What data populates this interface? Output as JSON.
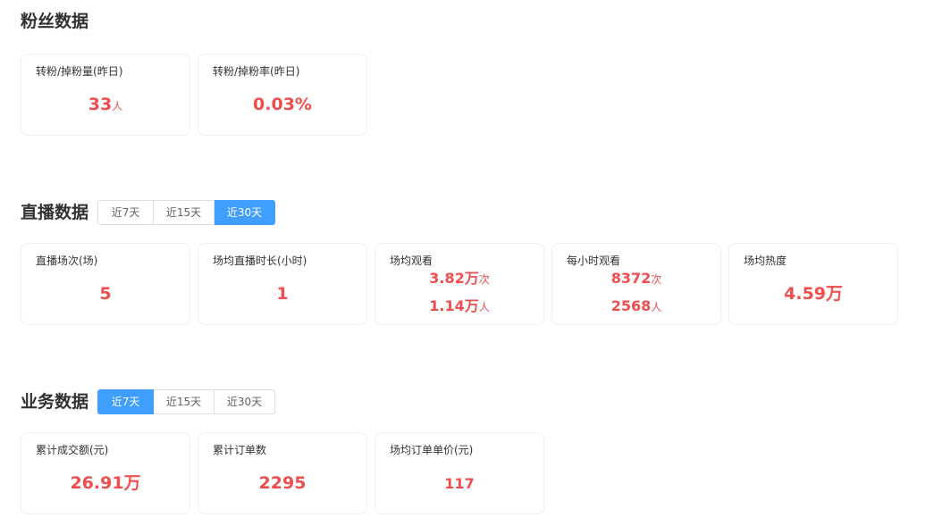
{
  "fans": {
    "title": "粉丝数据",
    "cards": [
      {
        "label": "转粉/掉粉量(昨日)",
        "value": "33",
        "unit": "人"
      },
      {
        "label": "转粉/掉粉率(昨日)",
        "value": "0.03%",
        "unit": ""
      }
    ]
  },
  "live": {
    "title": "直播数据",
    "tabs": [
      "近7天",
      "近15天",
      "近30天"
    ],
    "active_tab": "近30天",
    "cards": [
      {
        "label": "直播场次(场)",
        "value": "5",
        "unit": ""
      },
      {
        "label": "场均直播时长(小时)",
        "value": "1",
        "unit": ""
      },
      {
        "label": "场均观看",
        "line1_value": "3.82万",
        "line1_unit": "次",
        "line2_value": "1.14万",
        "line2_unit": "人"
      },
      {
        "label": "每小时观看",
        "line1_value": "8372",
        "line1_unit": "次",
        "line2_value": "2568",
        "line2_unit": "人"
      },
      {
        "label": "场均热度",
        "value": "4.59万",
        "unit": ""
      }
    ]
  },
  "business": {
    "title": "业务数据",
    "tabs": [
      "近7天",
      "近15天",
      "近30天"
    ],
    "active_tab": "近7天",
    "cards": [
      {
        "label": "累计成交额(元)",
        "value": "26.91万",
        "unit": ""
      },
      {
        "label": "累计订单数",
        "value": "2295",
        "unit": ""
      },
      {
        "label": "场均订单单价(元)",
        "value": "117",
        "unit": ""
      }
    ]
  },
  "colors": {
    "accent": "#409eff",
    "value": "#f04e4e",
    "border": "#ebeef5"
  }
}
